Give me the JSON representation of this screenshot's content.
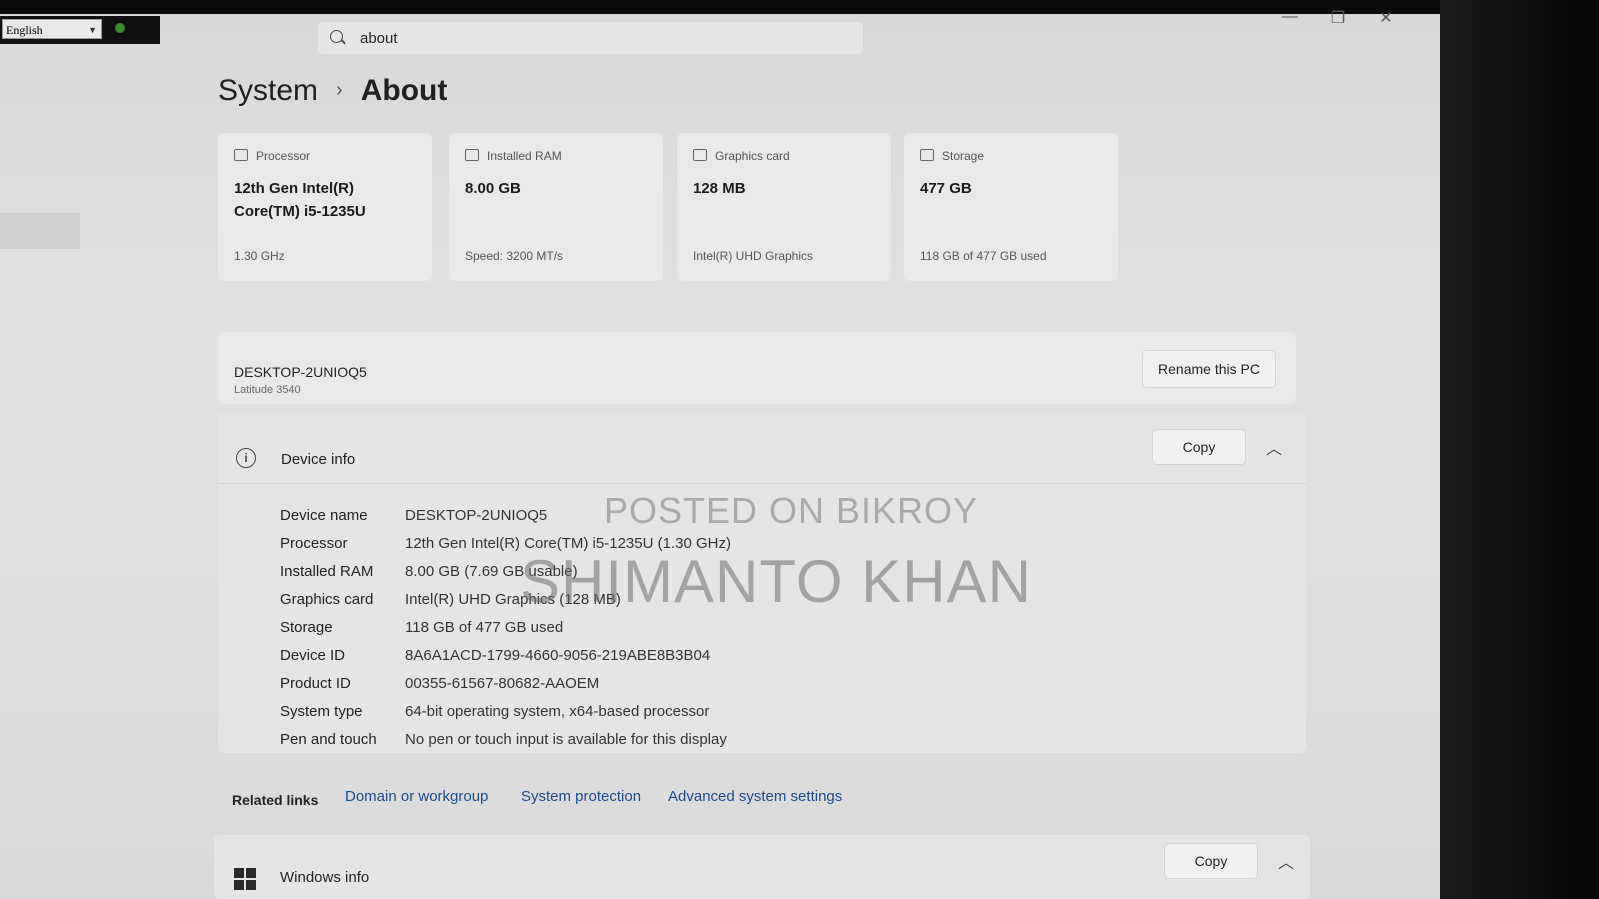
{
  "language_bar": {
    "selected": "English"
  },
  "search": {
    "value": "about"
  },
  "window_controls": {
    "minimize": "—",
    "maximize": "❐",
    "close": "✕"
  },
  "breadcrumb": {
    "parent": "System",
    "separator": "›",
    "current": "About"
  },
  "spec_cards": [
    {
      "label": "Processor",
      "value": "12th Gen Intel(R) Core(TM) i5-1235U",
      "sub": "1.30 GHz"
    },
    {
      "label": "Installed RAM",
      "value": "8.00 GB",
      "sub": "Speed: 3200 MT/s"
    },
    {
      "label": "Graphics card",
      "value": "128 MB",
      "sub": "Intel(R) UHD Graphics"
    },
    {
      "label": "Storage",
      "value": "477 GB",
      "sub": "118 GB of 477 GB used"
    }
  ],
  "pc": {
    "name": "DESKTOP-2UNIOQ5",
    "model": "Latitude 3540",
    "rename_label": "Rename this PC"
  },
  "device_info": {
    "title": "Device info",
    "copy_label": "Copy",
    "rows": [
      {
        "key": "Device name",
        "value": "DESKTOP-2UNIOQ5"
      },
      {
        "key": "Processor",
        "value": "12th Gen Intel(R) Core(TM) i5-1235U (1.30 GHz)"
      },
      {
        "key": "Installed RAM",
        "value": "8.00 GB (7.69 GB usable)"
      },
      {
        "key": "Graphics card",
        "value": "Intel(R) UHD Graphics (128 MB)"
      },
      {
        "key": "Storage",
        "value": "118 GB of 477 GB used"
      },
      {
        "key": "Device ID",
        "value": "8A6A1ACD-1799-4660-9056-219ABE8B3B04"
      },
      {
        "key": "Product ID",
        "value": "00355-61567-80682-AAOEM"
      },
      {
        "key": "System type",
        "value": "64-bit operating system, x64-based processor"
      },
      {
        "key": "Pen and touch",
        "value": "No pen or touch input is available for this display"
      }
    ]
  },
  "related_links": {
    "label": "Related links",
    "links": [
      "Domain or workgroup",
      "System protection",
      "Advanced system settings"
    ]
  },
  "windows_info": {
    "title": "Windows info",
    "copy_label": "Copy"
  },
  "watermark": {
    "line1": "POSTED ON BIKROY",
    "line2": "SHIMANTO KHAN"
  }
}
